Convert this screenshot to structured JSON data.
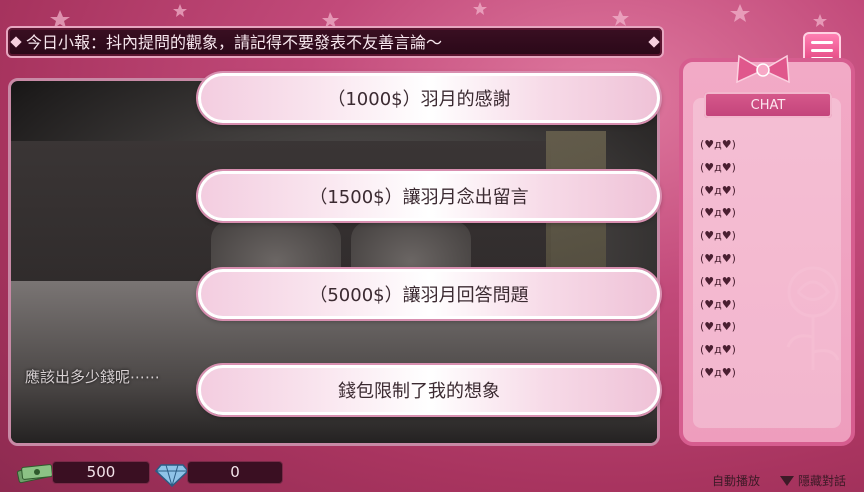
{
  "ticker": {
    "text": "今日小報：抖內提問的觀象，請記得不要發表不友善言論～"
  },
  "dialog": {
    "text": "應該出多少錢呢⋯⋯"
  },
  "choices": [
    {
      "label": "（1000$）羽月的感謝"
    },
    {
      "label": "（1500$）讓羽月念出留言"
    },
    {
      "label": "（5000$）讓羽月回答問題"
    },
    {
      "label": "錢包限制了我的想象"
    }
  ],
  "chat": {
    "header": "CHAT",
    "messages": [
      "(♥д♥)",
      "(♥д♥)",
      "(♥д♥)",
      "(♥д♥)",
      "(♥д♥)",
      "(♥д♥)",
      "(♥д♥)",
      "(♥д♥)",
      "(♥д♥)",
      "(♥д♥)",
      "(♥д♥)"
    ]
  },
  "status": {
    "money": "500",
    "gems": "0"
  },
  "controls": {
    "auto_play": "自動播放",
    "hide_dialog": "隱藏對話"
  },
  "icons": {
    "menu": "hamburger-icon",
    "money": "cash-stack-icon",
    "gems": "diamond-icon",
    "hide": "triangle-down-icon"
  },
  "colors": {
    "accent": "#e0407c",
    "panel": "#3a0f22",
    "chat_bg": "#f2aac6"
  }
}
